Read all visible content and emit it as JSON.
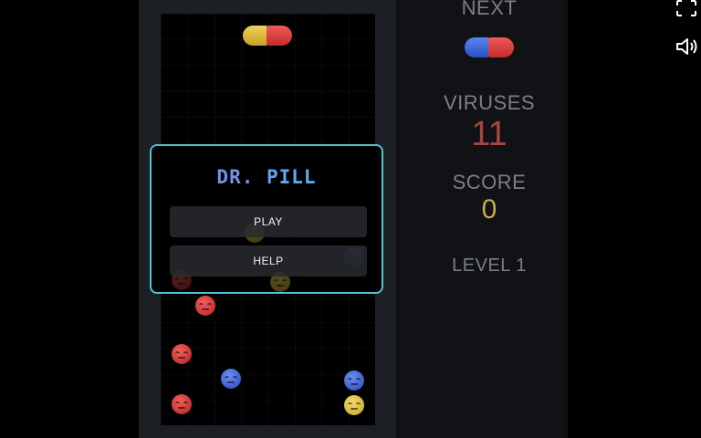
{
  "side_panel": {
    "next_label": "NEXT",
    "viruses_label": "VIRUSES",
    "viruses_count": "11",
    "score_label": "SCORE",
    "score_value": "0",
    "level_label": "LEVEL 1"
  },
  "menu": {
    "title": "DR. PILL",
    "play_label": "PLAY",
    "help_label": "HELP"
  },
  "falling_pill": [
    "yellow",
    "red"
  ],
  "next_pill": [
    "blue",
    "red"
  ],
  "board": {
    "columns": 8,
    "rows": 16,
    "viruses": [
      {
        "color": "red",
        "col": 1,
        "row": 11
      },
      {
        "color": "red",
        "col": 0,
        "row": 13
      },
      {
        "color": "blue",
        "col": 2,
        "row": 14
      },
      {
        "color": "blue",
        "col": 7,
        "row": 14
      },
      {
        "color": "red",
        "col": 0,
        "row": 15
      },
      {
        "color": "yellow",
        "col": 7,
        "row": 15
      }
    ]
  },
  "colors": {
    "accent_border": "#4fc3cf",
    "viruses_count_color": "#a8463e",
    "score_color": "#c9a94a",
    "red": "#e04040",
    "blue": "#3f66d8",
    "yellow": "#e5c144"
  }
}
